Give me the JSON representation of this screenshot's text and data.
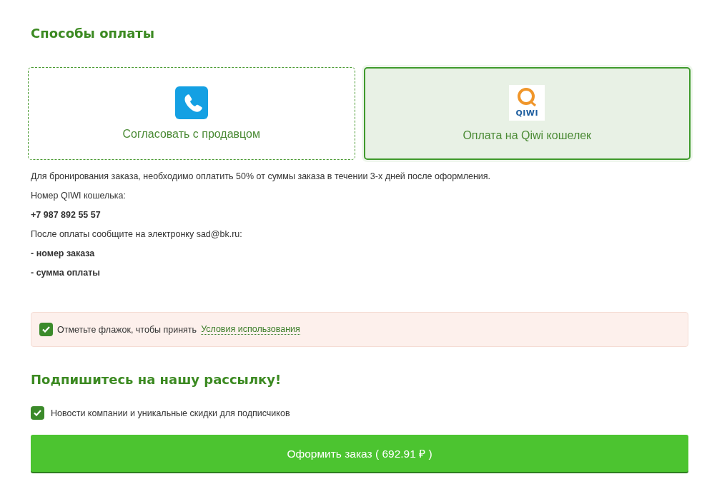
{
  "payment_section": {
    "title": "Способы оплаты",
    "methods": [
      {
        "kind": "phone",
        "label": "Согласовать с продавцом",
        "selected": false
      },
      {
        "kind": "qiwi",
        "label": "Оплата на Qiwi кошелек",
        "logo_text": "QIWI",
        "selected": true
      }
    ],
    "info_lines": [
      {
        "kind": "plain",
        "text": "Для бронирования заказа, необходимо оплатить 50% от суммы заказа в течении 3-х дней после оформления."
      },
      {
        "kind": "plain",
        "text": "Номер QIWI кошелька:"
      },
      {
        "kind": "bold",
        "text": "+7 987 892 55 57"
      },
      {
        "kind": "plain",
        "text": "После оплаты сообщите на электронку sad@bk.ru:"
      },
      {
        "kind": "bold",
        "text": "- номер заказа"
      },
      {
        "kind": "bold",
        "text": "- сумма оплаты"
      }
    ]
  },
  "terms": {
    "checked": true,
    "text": "Отметьте флажок, чтобы принять",
    "link": "Условия использования"
  },
  "newsletter": {
    "title": "Подпишитесь на нашу рассылку!",
    "checked": true,
    "label": "Новости компании и уникальные скидки для подписчиков"
  },
  "submit_button": "Оформить заказ ( 692.91 ₽ )"
}
